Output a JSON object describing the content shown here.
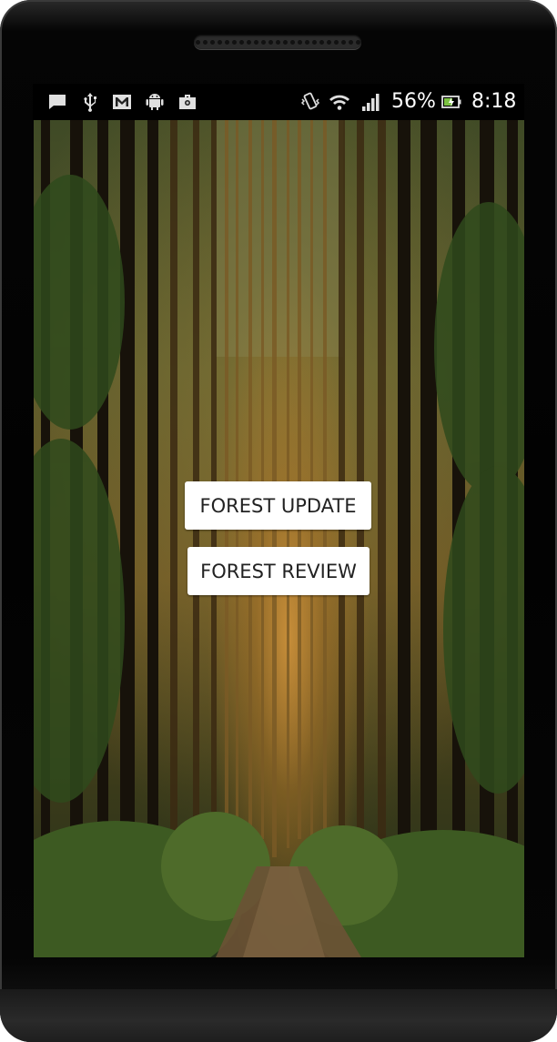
{
  "status_bar": {
    "left_icons": [
      "message-icon",
      "usb-icon",
      "gmail-icon",
      "android-icon",
      "briefcase-icon"
    ],
    "right_icons": [
      "vibrate-icon",
      "wifi-icon",
      "signal-icon",
      "battery-charging-icon"
    ],
    "battery_percent": "56%",
    "time": "8:18"
  },
  "main": {
    "background": "forest-image",
    "buttons": {
      "update_label": "FOREST UPDATE",
      "review_label": "FOREST REVIEW"
    }
  }
}
